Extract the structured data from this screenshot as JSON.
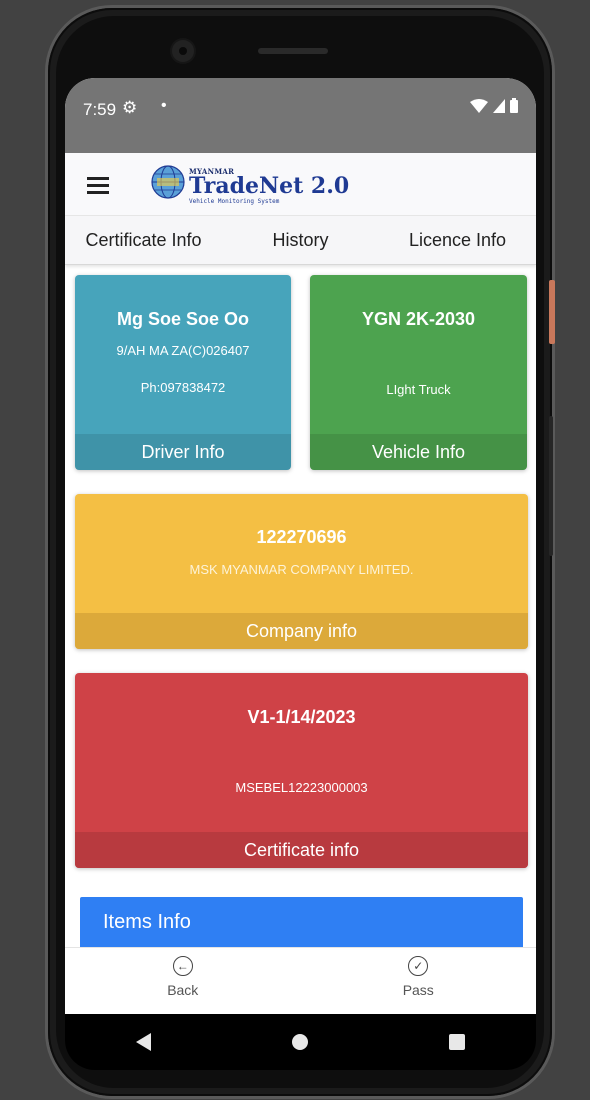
{
  "status_bar": {
    "time": "7:59",
    "gear_icon": "⚙",
    "dot": "•"
  },
  "app_bar": {
    "logo_small": "MYANMAR",
    "logo_main": "TradeNet 2.0",
    "logo_sub": "Vehicle Monitoring System"
  },
  "tabs": [
    {
      "label": "Certificate Info"
    },
    {
      "label": "History"
    },
    {
      "label": "Licence Info"
    }
  ],
  "driver_card": {
    "name": "Mg Soe Soe Oo",
    "licence": "9/AH MA ZA(C)026407",
    "phone": "Ph:097838472",
    "footer": "Driver Info",
    "color": "#47a4bb"
  },
  "vehicle_card": {
    "plate": "YGN 2K-2030",
    "type": "LIght Truck",
    "footer": "Vehicle Info",
    "color": "#4da34f"
  },
  "company_card": {
    "id": "122270696",
    "name": "MSK MYANMAR COMPANY LIMITED.",
    "footer": "Company info",
    "color": "#f4bf44"
  },
  "certificate_card": {
    "number": "V1-1/14/2023",
    "code": "MSEBEL12223000003",
    "footer": "Certificate info",
    "color": "#cf4247"
  },
  "items_section": {
    "title": "Items Info",
    "color": "#2f7ff3"
  },
  "bottom_nav": {
    "back": {
      "label": "Back",
      "icon": "arrow-left-circle-icon"
    },
    "pass": {
      "label": "Pass",
      "icon": "check-circle-icon"
    }
  }
}
